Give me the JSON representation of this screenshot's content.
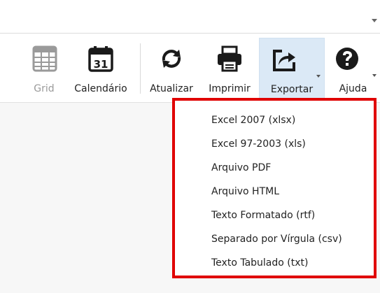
{
  "toolbar": {
    "buttons": [
      {
        "label": "Grid",
        "icon": "grid-icon",
        "disabled": true
      },
      {
        "label": "Calendário",
        "icon": "calendar-icon",
        "icon_text": "31"
      },
      {
        "label": "Atualizar",
        "icon": "refresh-icon"
      },
      {
        "label": "Imprimir",
        "icon": "printer-icon"
      },
      {
        "label": "Exportar",
        "icon": "export-icon",
        "active": true
      },
      {
        "label": "Ajuda",
        "icon": "help-icon"
      }
    ]
  },
  "export_menu": {
    "items": [
      "Excel 2007 (xlsx)",
      "Excel 97-2003 (xls)",
      "Arquivo PDF",
      "Arquivo HTML",
      "Texto Formatado (rtf)",
      "Separado por Vírgula (csv)",
      "Texto Tabulado (txt)"
    ],
    "highlight_color": "#e00000"
  },
  "colors": {
    "active_button_bg": "#dbe9f6",
    "icon_dark": "#1a1a1a",
    "disabled_text": "#9a9a9a"
  }
}
